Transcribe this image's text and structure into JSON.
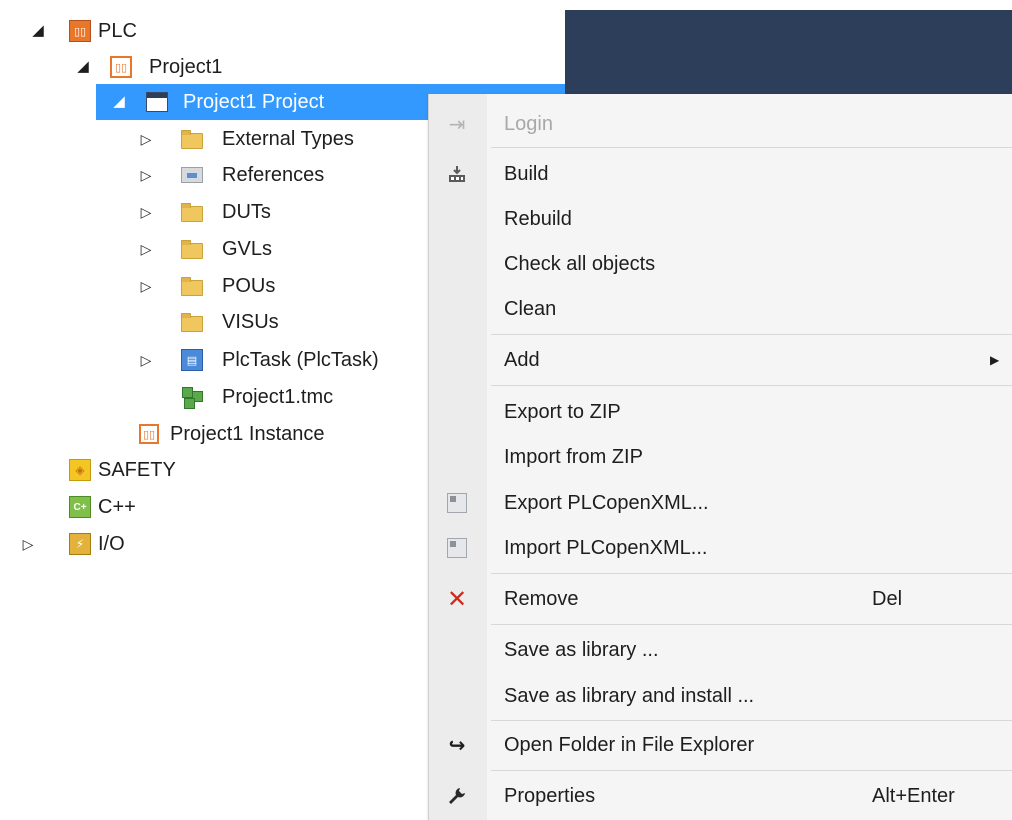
{
  "tree": {
    "plc": {
      "label": "PLC"
    },
    "project1": {
      "label": "Project1"
    },
    "project1_project": {
      "label": "Project1 Project"
    },
    "external_types": {
      "label": "External Types"
    },
    "references": {
      "label": "References"
    },
    "duts": {
      "label": "DUTs"
    },
    "gvls": {
      "label": "GVLs"
    },
    "pous": {
      "label": "POUs"
    },
    "visus": {
      "label": "VISUs"
    },
    "plctask": {
      "label": "PlcTask (PlcTask)"
    },
    "tmc": {
      "label": "Project1.tmc"
    },
    "instance": {
      "label": "Project1 Instance"
    },
    "safety": {
      "label": "SAFETY"
    },
    "cpp": {
      "label": "C++"
    },
    "io": {
      "label": "I/O"
    }
  },
  "menu": {
    "login": "Login",
    "build": "Build",
    "rebuild": "Rebuild",
    "check_all": "Check all objects",
    "clean": "Clean",
    "add": "Add",
    "export_zip": "Export to ZIP",
    "import_zip": "Import from ZIP",
    "export_xml": "Export PLCopenXML...",
    "import_xml": "Import PLCopenXML...",
    "remove": "Remove",
    "remove_shortcut": "Del",
    "save_library": "Save as library ...",
    "save_library_install": "Save as library and install ...",
    "open_folder": "Open Folder in File Explorer",
    "properties": "Properties",
    "properties_shortcut": "Alt+Enter"
  },
  "colors": {
    "selection": "#3399ff",
    "panel_dark": "#2d3e5a",
    "menu_bg": "#f5f5f5",
    "remove_icon": "#cc2b1d"
  },
  "icons": {
    "plc": "plc-icon",
    "project": "plc-project-icon",
    "folder": "folder-icon",
    "references": "references-icon",
    "task": "task-icon",
    "tmc": "tmc-icon",
    "safety": "safety-icon",
    "cpp": "cpp-icon",
    "io": "io-icon",
    "login": "login-icon",
    "build": "build-icon",
    "xml": "xml-icon",
    "remove": "remove-x-icon",
    "open_folder": "redo-arrow-icon",
    "properties": "wrench-icon",
    "submenu": "submenu-arrow-icon"
  }
}
